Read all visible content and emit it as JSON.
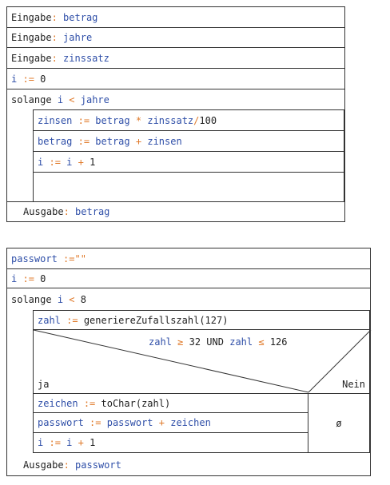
{
  "diagram1": {
    "rows": [
      {
        "label": "Eingabe",
        "sep": ":",
        "var": "betrag"
      },
      {
        "label": "Eingabe",
        "sep": ":",
        "var": "jahre"
      },
      {
        "label": "Eingabe",
        "sep": ":",
        "var": "zinssatz"
      }
    ],
    "init": {
      "var": "i",
      "op": ":=",
      "value": "0"
    },
    "loop": {
      "keyword": "solange",
      "var": "i",
      "op": "<",
      "limit": "jahre"
    },
    "body": [
      {
        "var": "zinsen",
        "op": ":=",
        "a": "betrag",
        "op2": "*",
        "b": "zinssatz",
        "op3": "/",
        "c": "100"
      },
      {
        "var": "betrag",
        "op": ":=",
        "a": "betrag",
        "op2": "+",
        "b": "zinsen"
      },
      {
        "var": "i",
        "op": ":=",
        "a": "i",
        "op2": "+",
        "b": "1"
      }
    ],
    "output": {
      "label": "Ausgabe",
      "sep": ":",
      "var": "betrag"
    }
  },
  "diagram2": {
    "init_pw": {
      "var": "passwort",
      "op": ":=",
      "value": "\"\""
    },
    "init_i": {
      "var": "i",
      "op": ":=",
      "value": "0"
    },
    "loop": {
      "keyword": "solange",
      "var": "i",
      "op": "<",
      "limit": "8"
    },
    "assign": {
      "var": "zahl",
      "op": ":=",
      "call": "generiereZufallszahl(127)"
    },
    "condition": {
      "v1": "zahl",
      "op1": "≥",
      "n1": "32",
      "and": "UND",
      "v2": "zahl",
      "op2": "≤",
      "n2": "126"
    },
    "yes_label": "ja",
    "no_label": "Nein",
    "yes_body": [
      {
        "var": "zeichen",
        "op": ":=",
        "call": "toChar(zahl)"
      },
      {
        "var": "passwort",
        "op": ":=",
        "a": "passwort",
        "op2": "+",
        "b": "zeichen"
      },
      {
        "var": "i",
        "op": ":=",
        "a": "i",
        "op2": "+",
        "b": "1"
      }
    ],
    "no_body": "ø",
    "output": {
      "label": "Ausgabe",
      "sep": ":",
      "var": "passwort"
    }
  },
  "colors": {
    "keyword": "#222222",
    "variable": "#2f4fa8",
    "operator": "#e07a2a",
    "border": "#333333"
  }
}
